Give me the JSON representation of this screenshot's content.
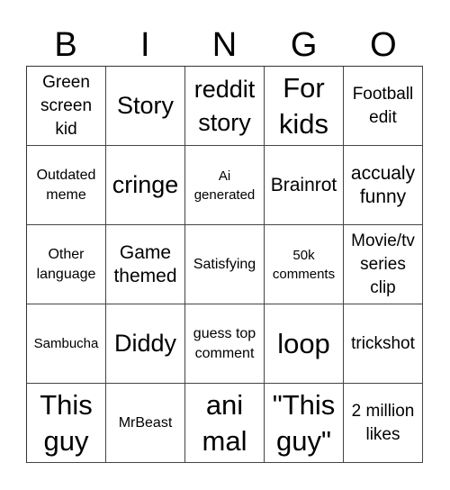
{
  "card": {
    "header": [
      "B",
      "I",
      "N",
      "G",
      "O"
    ],
    "rows": [
      [
        "Green screen kid",
        "Story",
        "reddit story",
        "For kids",
        "Football edit"
      ],
      [
        "Outdated meme",
        "cringe",
        "Ai generated",
        "Brainrot",
        "accualy funny"
      ],
      [
        "Other language",
        "Game themed",
        "Satisfying",
        "50k comments",
        "Movie/tv series clip"
      ],
      [
        "Sambucha",
        "Diddy",
        "guess top comment",
        "loop",
        "trickshot"
      ],
      [
        "This guy",
        "MrBeast",
        "ani mal",
        "\"This guy\"",
        "2 million likes"
      ]
    ]
  }
}
